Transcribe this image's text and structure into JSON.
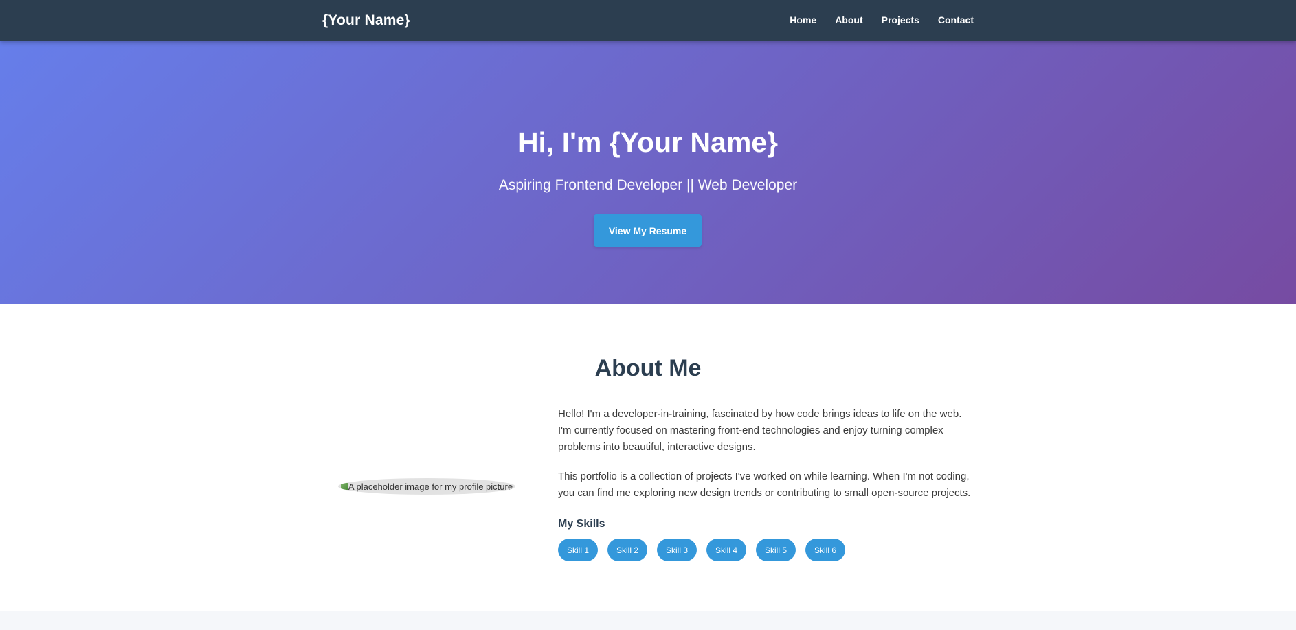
{
  "nav": {
    "logo": "{Your Name}",
    "links": [
      {
        "label": "Home"
      },
      {
        "label": "About"
      },
      {
        "label": "Projects"
      },
      {
        "label": "Contact"
      }
    ]
  },
  "hero": {
    "title": "Hi, I'm {Your Name}",
    "subtitle": "Aspiring Frontend Developer || Web Developer",
    "button_label": "View My Resume"
  },
  "about": {
    "title": "About Me",
    "profile_image_alt": "A placeholder image for my profile picture",
    "paragraphs": [
      "Hello! I'm a developer-in-training, fascinated by how code brings ideas to life on the web. I'm currently focused on mastering front-end technologies and enjoy turning complex problems into beautiful, interactive designs.",
      "This portfolio is a collection of projects I've worked on while learning. When I'm not coding, you can find me exploring new design trends or contributing to small open-source projects."
    ],
    "skills_heading": "My Skills",
    "skills": [
      "Skill 1",
      "Skill 2",
      "Skill 3",
      "Skill 4",
      "Skill 5",
      "Skill 6"
    ]
  },
  "colors": {
    "navbar_bg": "#2c3e50",
    "hero_gradient_start": "#667eea",
    "hero_gradient_end": "#764ba2",
    "accent": "#3498db",
    "heading": "#2c3e50"
  }
}
